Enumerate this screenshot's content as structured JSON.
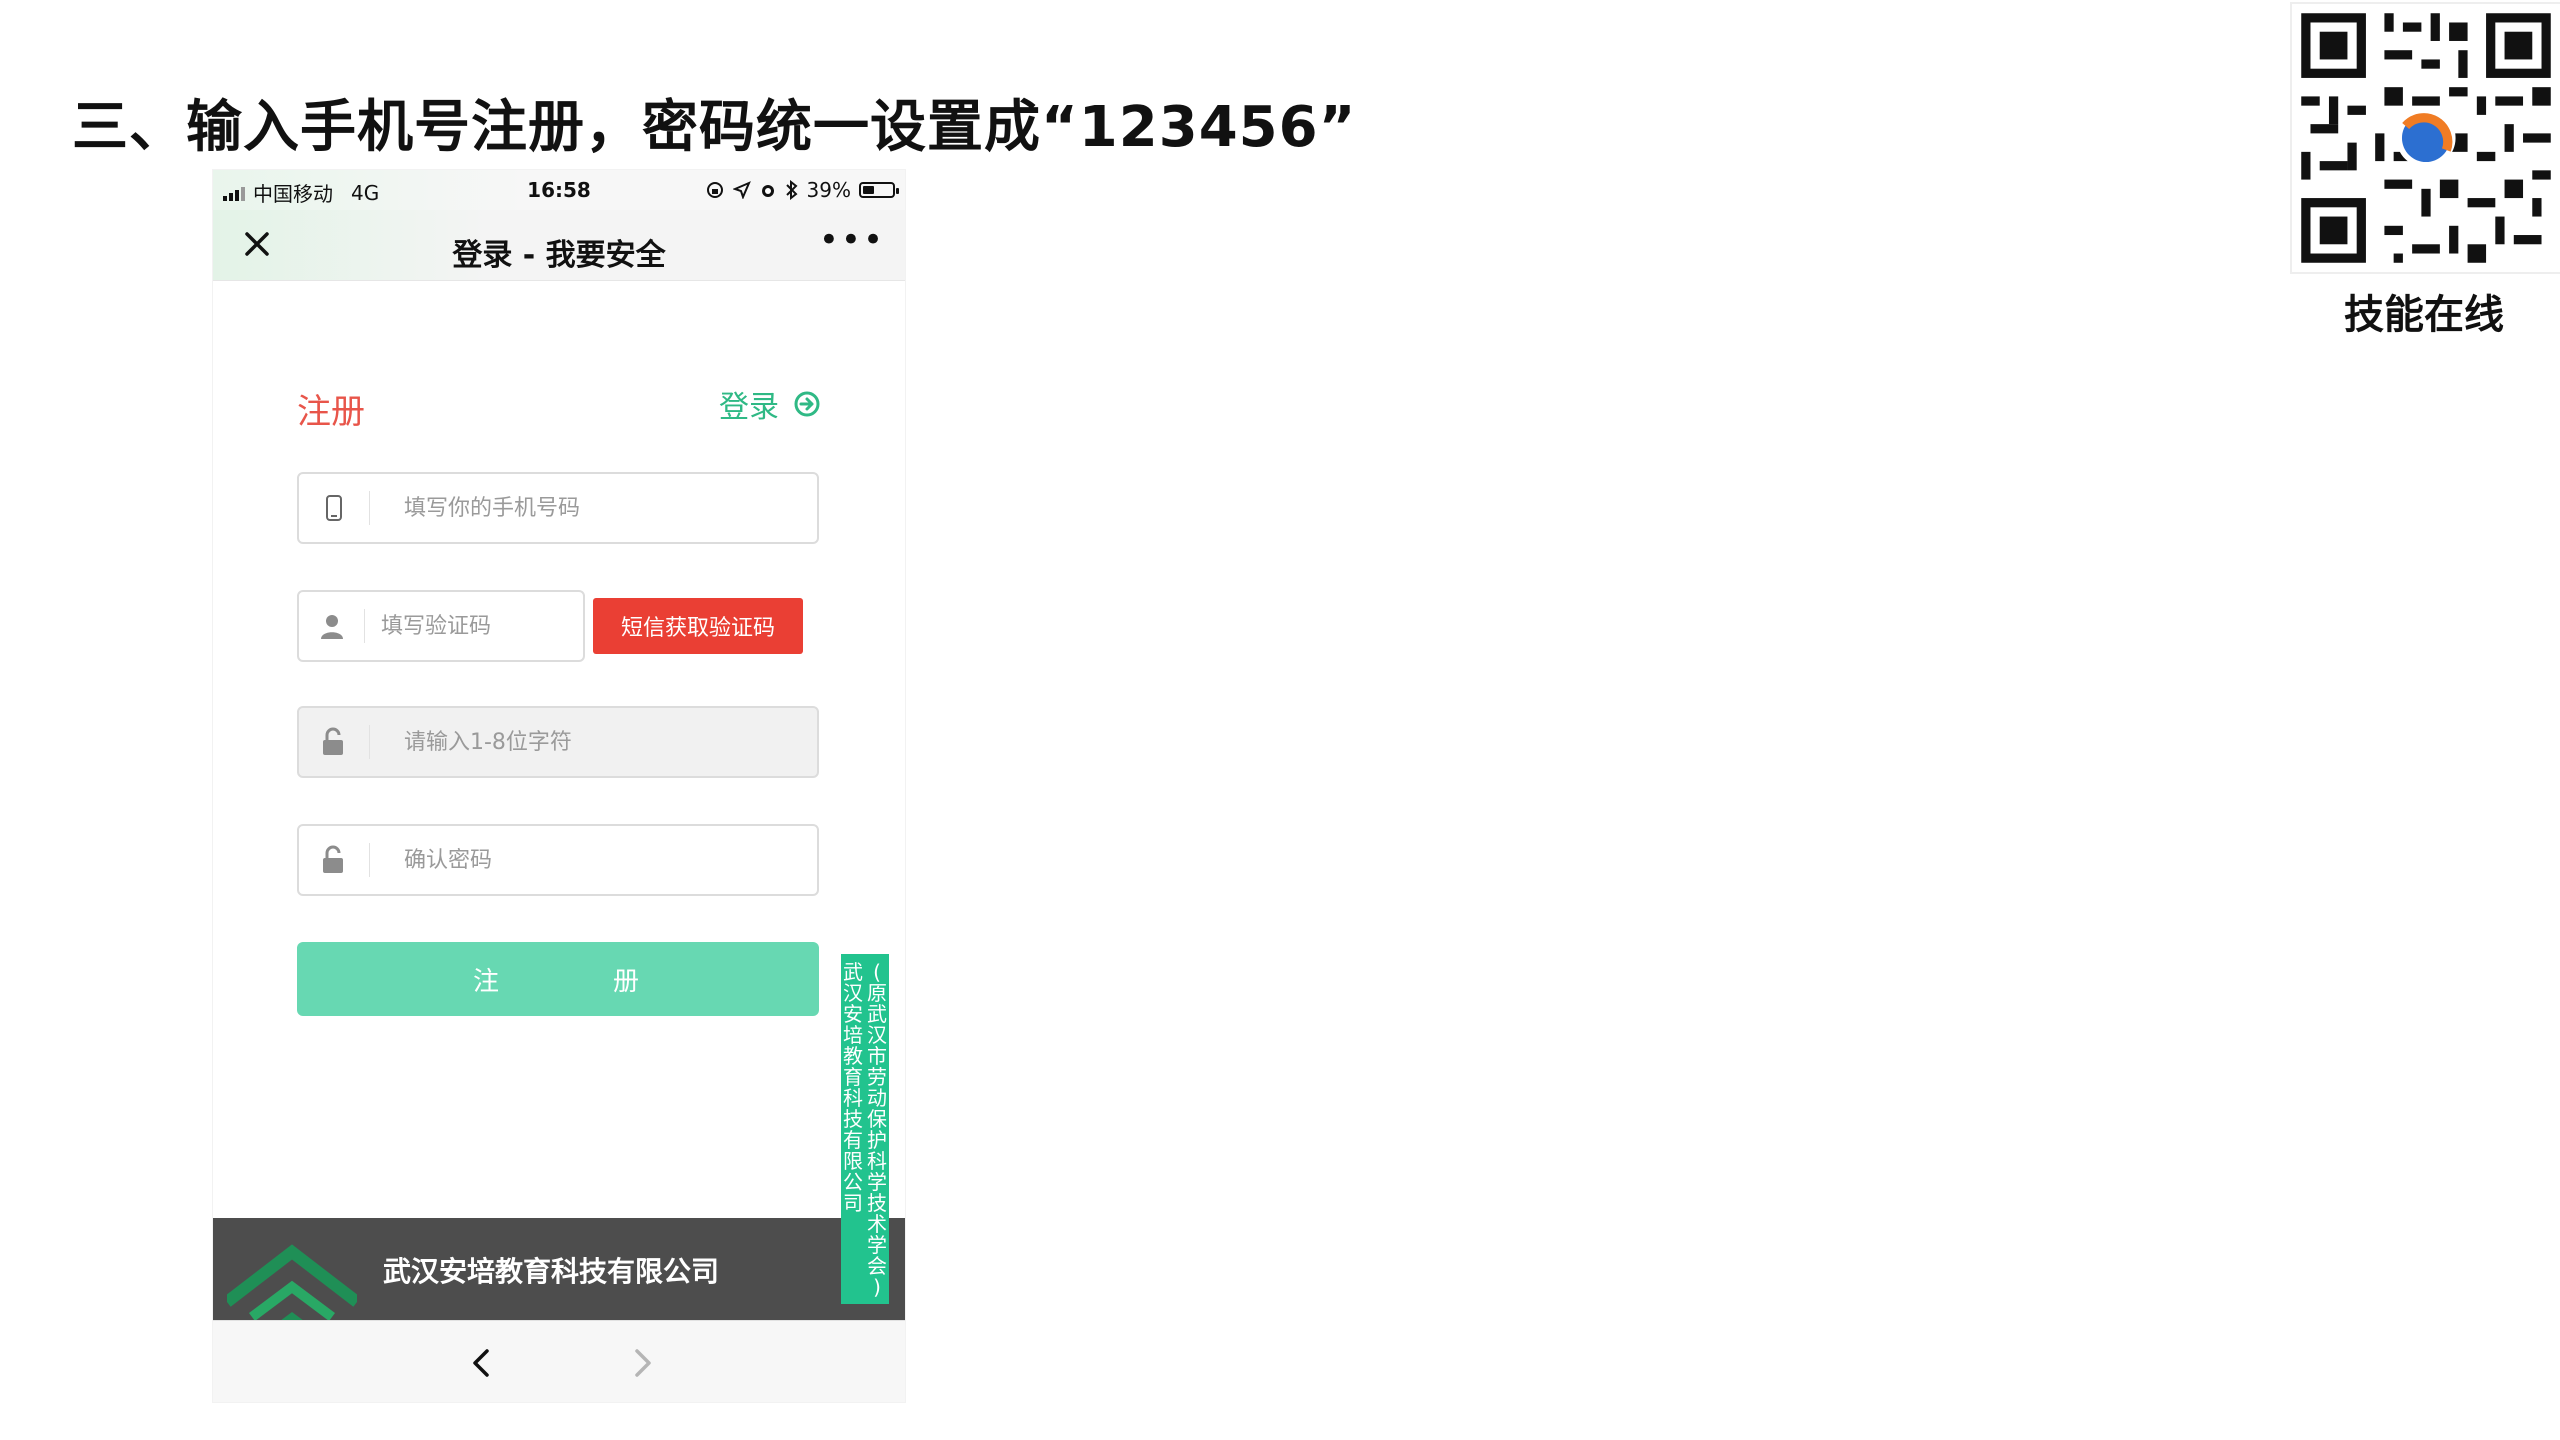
{
  "slide": {
    "title": "三、输入手机号注册，密码统一设置成“123456”",
    "qr_caption": "技能在线"
  },
  "status_bar": {
    "carrier": "中国移动",
    "network": "4G",
    "time": "16:58",
    "battery": "39%",
    "battery_level": 0.39
  },
  "nav": {
    "title": "登录 - 我要安全",
    "more": "•••"
  },
  "form": {
    "heading": "注册",
    "login_link": "登录",
    "phone_placeholder": "填写你的手机号码",
    "code_placeholder": "填写验证码",
    "sms_button": "短信获取验证码",
    "password_placeholder": "请输入1-8位字符",
    "confirm_placeholder": "确认密码",
    "submit_char1": "注",
    "submit_char2": "册"
  },
  "footer": {
    "company": "武汉安培教育科技有限公司"
  },
  "badge": {
    "col1": [
      "武",
      "汉",
      "安",
      "培",
      "教",
      "育",
      "科",
      "技",
      "有",
      "限",
      "公",
      "司"
    ],
    "col2": [
      "(",
      "原",
      "武",
      "汉",
      "市",
      "劳",
      "动",
      "保",
      "护",
      "科",
      "学",
      "技",
      "术",
      "学",
      "会",
      ")"
    ]
  },
  "colors": {
    "accent_green": "#2fb985",
    "button_green": "#67d8b2",
    "heading_red": "#e8554a",
    "sms_red": "#ea3f34",
    "footer_gray": "#4d4d4d"
  },
  "icons": {
    "close": "close-icon",
    "login_arrow": "arrow-right-circle-icon",
    "phone": "phone-icon",
    "user": "user-icon",
    "lock": "unlock-icon",
    "back": "chevron-left-icon",
    "forward": "chevron-right-icon"
  }
}
